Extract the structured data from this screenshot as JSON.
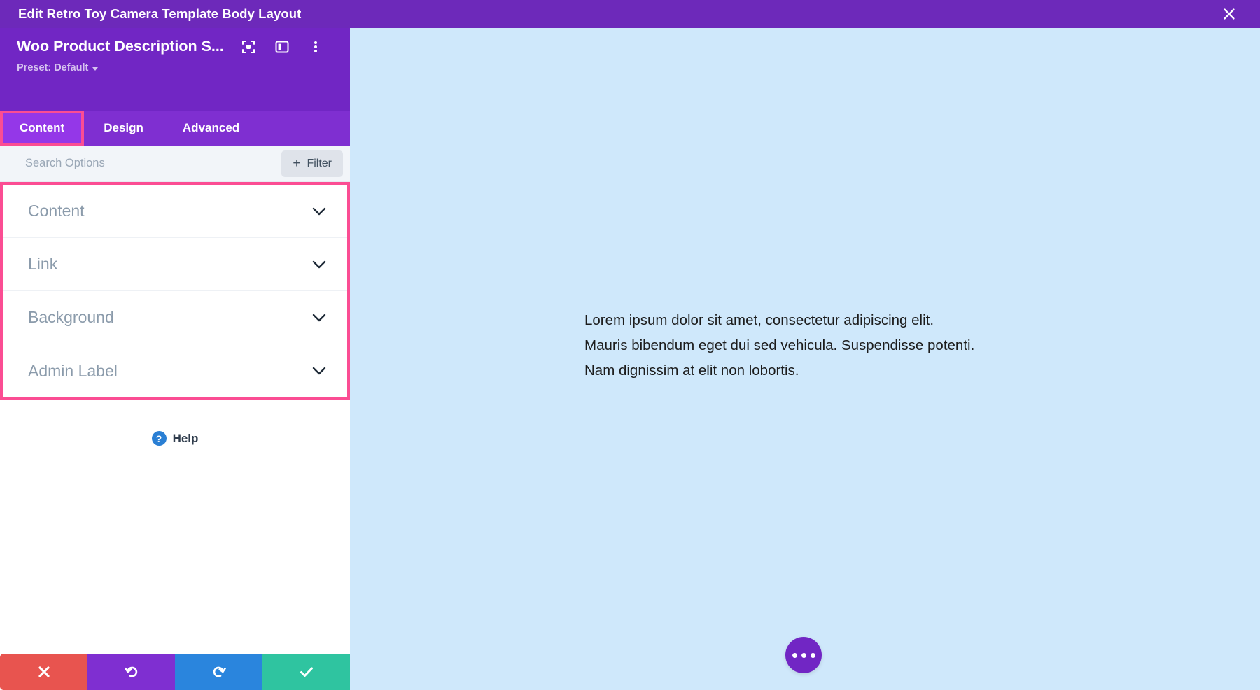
{
  "titlebar": {
    "title": "Edit Retro Toy Camera Template Body Layout",
    "close_icon": "close-icon"
  },
  "panel_header": {
    "module_name": "Woo Product Description S...",
    "preset_label": "Preset: Default",
    "icons": [
      {
        "name": "focus-target-icon"
      },
      {
        "name": "layout-panel-icon"
      },
      {
        "name": "more-vertical-icon"
      }
    ]
  },
  "tabs": [
    {
      "label": "Content",
      "active": true,
      "highlighted": true
    },
    {
      "label": "Design",
      "active": false,
      "highlighted": false
    },
    {
      "label": "Advanced",
      "active": false,
      "highlighted": false
    }
  ],
  "search": {
    "placeholder": "Search Options",
    "value": "",
    "filter_label": "Filter",
    "filter_plus": "+"
  },
  "accordion": {
    "highlighted": true,
    "sections": [
      {
        "label": "Content",
        "expanded": false
      },
      {
        "label": "Link",
        "expanded": false
      },
      {
        "label": "Background",
        "expanded": false
      },
      {
        "label": "Admin Label",
        "expanded": false
      }
    ]
  },
  "help": {
    "label": "Help",
    "icon_glyph": "?"
  },
  "footer_buttons": [
    {
      "name": "cancel-button",
      "icon": "close-x-icon",
      "color": "#e8544f"
    },
    {
      "name": "undo-button",
      "icon": "undo-arrow-icon",
      "color": "#7f2fd1"
    },
    {
      "name": "redo-button",
      "icon": "redo-arrow-icon",
      "color": "#2a85dd"
    },
    {
      "name": "save-button",
      "icon": "checkmark-icon",
      "color": "#2fc4a0"
    }
  ],
  "canvas": {
    "background_color": "#cfe8fb",
    "paragraphs": [
      "Lorem ipsum dolor sit amet, consectetur adipiscing elit.",
      "Mauris bibendum eget dui sed vehicula. Suspendisse potenti.",
      "Nam dignissim at elit non lobortis."
    ],
    "fab": {
      "name": "page-settings-fab",
      "icon": "three-dots-icon",
      "color": "#7126c4"
    }
  },
  "colors": {
    "titlebar": "#6d29ba",
    "panel_header": "#7126c4",
    "tabbar": "#7f2fd1",
    "tab_active": "#9437e8",
    "highlight_pink": "#fb4d93",
    "searchbar": "#f2f5f9"
  }
}
